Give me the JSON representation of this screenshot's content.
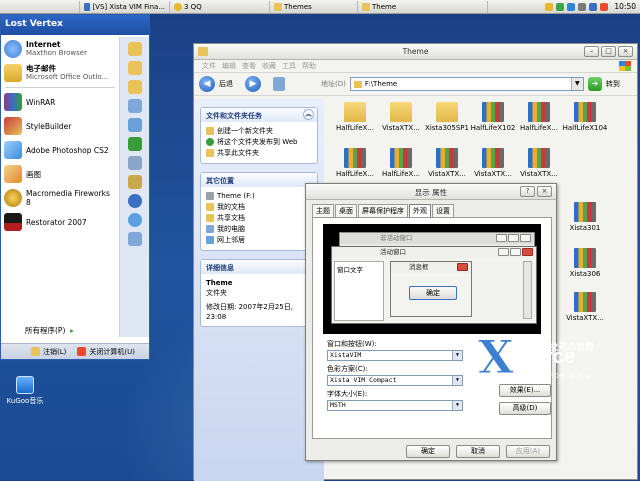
{
  "taskbar": {
    "tasks": [
      {
        "label": "[VS] Xista VIM Fina...",
        "color": "#3a6fc4"
      },
      {
        "label": "3 QQ",
        "color": "#e7b72e"
      },
      {
        "label": "Themes",
        "color": "#e8c35a"
      },
      {
        "label": "Theme",
        "color": "#e8c35a"
      }
    ],
    "clock": "10:50",
    "tray_colors": [
      "#e7b72e",
      "#3aa647",
      "#2f86d9",
      "#7a7a7a",
      "#3a6fc4",
      "#e94b2f"
    ]
  },
  "start_menu": {
    "user": "Lost Vertex",
    "pinned": [
      {
        "title": "Internet",
        "subtitle": "Maxthon Browser",
        "icon": "maxthon-icon",
        "color": "#3f7fd4"
      },
      {
        "title": "电子邮件",
        "subtitle": "Microsoft Office Outlo...",
        "icon": "outlook-icon",
        "color": "#d9a92b"
      }
    ],
    "recent": [
      {
        "title": "WinRAR",
        "icon": "winrar-icon",
        "color": "#8c3b8a"
      },
      {
        "title": "StyleBuilder",
        "icon": "stylebuilder-icon",
        "color": "#c43c3c"
      },
      {
        "title": "Adobe Photoshop CS2",
        "icon": "photoshop-icon",
        "color": "#3a8bd6"
      },
      {
        "title": "画图",
        "icon": "paint-icon",
        "color": "#e08b2e"
      },
      {
        "title": "Macromedia Fireworks 8",
        "icon": "fireworks-icon",
        "color": "#e2a91f"
      },
      {
        "title": "Restorator 2007",
        "icon": "restorator-icon",
        "color": "#b01f1f"
      }
    ],
    "all_programs": "所有程序(P)",
    "logoff": "注销(L)",
    "shutdown": "关闭计算机(U)",
    "quick_icon_colors": [
      "#e8c35a",
      "#e8c35a",
      "#e8c35a",
      "#7fa8d8",
      "#6aa0d8",
      "#3a9b3a",
      "#8aa7c9",
      "#c9a84a",
      "#3a6fc4",
      "#5aa0e0",
      "#7fa8d8"
    ]
  },
  "desktop": {
    "kugoo_label": "KuGoo音乐"
  },
  "explorer": {
    "title": "Theme",
    "menus": [
      "文件",
      "编辑",
      "查看",
      "收藏",
      "工具",
      "帮助"
    ],
    "back_label": "后退",
    "address_label": "地址(D)",
    "address": "F:\\Theme",
    "go_label": "转到",
    "tasks_panel": {
      "title": "文件和文件夹任务",
      "links": [
        "创建一个新文件夹",
        "将这个文件夹发布到 Web",
        "共享此文件夹"
      ]
    },
    "other_panel": {
      "title": "其它位置",
      "links": [
        "Theme (F:)",
        "我的文档",
        "共享文档",
        "我的电脑",
        "网上邻居"
      ]
    },
    "details_panel": {
      "title": "详细信息",
      "name": "Theme",
      "type": "文件夹",
      "modified": "修改日期: 2007年2月25日, 23:08"
    },
    "folders_row1": [
      {
        "label": "HalfLifeX...",
        "style": "plain"
      },
      {
        "label": "VistaXTX...",
        "style": "plain"
      },
      {
        "label": "Xista305SP1",
        "style": "plain"
      },
      {
        "label": "HalfLifeX102",
        "style": "books"
      },
      {
        "label": "HalfLifeX...",
        "style": "books"
      },
      {
        "label": "HalfLifeX104",
        "style": "books"
      }
    ],
    "folders_row2": [
      {
        "label": "HalfLifeX...",
        "style": "books"
      },
      {
        "label": "HalfLifeX...",
        "style": "books"
      },
      {
        "label": "VistaXTX...",
        "style": "books"
      },
      {
        "label": "VistaXTX...",
        "style": "books"
      },
      {
        "label": "VistaXTX...",
        "style": "books"
      }
    ],
    "folders_right": [
      {
        "label": "Xista301",
        "style": "books"
      },
      {
        "label": "Xista306",
        "style": "books"
      },
      {
        "label": "VistaXTX...",
        "style": "books"
      }
    ]
  },
  "dialog": {
    "title": "显示 属性",
    "help_glyph": "?",
    "close_glyph": "×",
    "tabs": [
      "主题",
      "桌面",
      "屏幕保护程序",
      "外观",
      "设置"
    ],
    "preview": {
      "inactive_title": "非活动窗口",
      "active_title": "活动窗口",
      "window_text": "窗口文字",
      "message_title": "消息框",
      "ok": "确定"
    },
    "windows_buttons_label": "窗口和按钮(W):",
    "windows_buttons_value": "XistaVIM",
    "color_scheme_label": "色彩方案(C):",
    "color_scheme_value": "Xista VIM Compact",
    "font_size_label": "字体大小(E):",
    "font_size_value": "MSTH",
    "effects_button": "效果(E)...",
    "advanced_button": "高级(D)",
    "ok_button": "确定",
    "cancel_button": "取消",
    "apply_button": "应用(A)"
  },
  "watermark": {
    "x": "X",
    "force": "-Force",
    "cn": "异次元の世界",
    "url": "WWW.X-FORCE.CN"
  }
}
